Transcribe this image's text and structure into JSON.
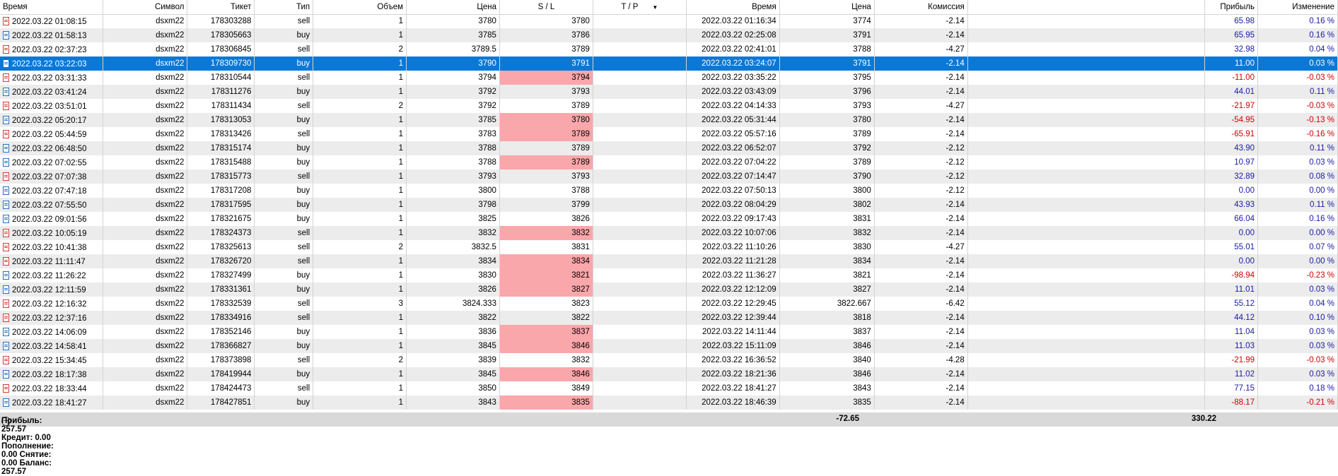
{
  "columns": [
    "Время",
    "Символ",
    "Тикет",
    "Тип",
    "Объем",
    "Цена",
    "S / L",
    "T / P",
    "Время",
    "Цена",
    "Комиссия",
    "",
    "Прибыль",
    "Изменение"
  ],
  "rows": [
    [
      "2022.03.22 01:08:15",
      "dsxm22",
      "178303288",
      "sell",
      "1",
      "3780",
      "3780",
      "",
      "2022.03.22 01:16:34",
      "3774",
      "-2.14",
      "",
      "65.98",
      "0.16 %"
    ],
    [
      "2022.03.22 01:58:13",
      "dsxm22",
      "178305663",
      "buy",
      "1",
      "3785",
      "3786",
      "",
      "2022.03.22 02:25:08",
      "3791",
      "-2.14",
      "",
      "65.95",
      "0.16 %"
    ],
    [
      "2022.03.22 02:37:23",
      "dsxm22",
      "178306845",
      "sell",
      "2",
      "3789.5",
      "3789",
      "",
      "2022.03.22 02:41:01",
      "3788",
      "-4.27",
      "",
      "32.98",
      "0.04 %"
    ],
    [
      "2022.03.22 03:22:03",
      "dsxm22",
      "178309730",
      "buy",
      "1",
      "3790",
      "3791",
      "",
      "2022.03.22 03:24:07",
      "3791",
      "-2.14",
      "",
      "11.00",
      "0.03 %"
    ],
    [
      "2022.03.22 03:31:33",
      "dsxm22",
      "178310544",
      "sell",
      "1",
      "3794",
      "3794",
      "",
      "2022.03.22 03:35:22",
      "3795",
      "-2.14",
      "",
      "-11.00",
      "-0.03 %"
    ],
    [
      "2022.03.22 03:41:24",
      "dsxm22",
      "178311276",
      "buy",
      "1",
      "3792",
      "3793",
      "",
      "2022.03.22 03:43:09",
      "3796",
      "-2.14",
      "",
      "44.01",
      "0.11 %"
    ],
    [
      "2022.03.22 03:51:01",
      "dsxm22",
      "178311434",
      "sell",
      "2",
      "3792",
      "3789",
      "",
      "2022.03.22 04:14:33",
      "3793",
      "-4.27",
      "",
      "-21.97",
      "-0.03 %"
    ],
    [
      "2022.03.22 05:20:17",
      "dsxm22",
      "178313053",
      "buy",
      "1",
      "3785",
      "3780",
      "",
      "2022.03.22 05:31:44",
      "3780",
      "-2.14",
      "",
      "-54.95",
      "-0.13 %"
    ],
    [
      "2022.03.22 05:44:59",
      "dsxm22",
      "178313426",
      "sell",
      "1",
      "3783",
      "3789",
      "",
      "2022.03.22 05:57:16",
      "3789",
      "-2.14",
      "",
      "-65.91",
      "-0.16 %"
    ],
    [
      "2022.03.22 06:48:50",
      "dsxm22",
      "178315174",
      "buy",
      "1",
      "3788",
      "3789",
      "",
      "2022.03.22 06:52:07",
      "3792",
      "-2.12",
      "",
      "43.90",
      "0.11 %"
    ],
    [
      "2022.03.22 07:02:55",
      "dsxm22",
      "178315488",
      "buy",
      "1",
      "3788",
      "3789",
      "",
      "2022.03.22 07:04:22",
      "3789",
      "-2.12",
      "",
      "10.97",
      "0.03 %"
    ],
    [
      "2022.03.22 07:07:38",
      "dsxm22",
      "178315773",
      "sell",
      "1",
      "3793",
      "3793",
      "",
      "2022.03.22 07:14:47",
      "3790",
      "-2.12",
      "",
      "32.89",
      "0.08 %"
    ],
    [
      "2022.03.22 07:47:18",
      "dsxm22",
      "178317208",
      "buy",
      "1",
      "3800",
      "3788",
      "",
      "2022.03.22 07:50:13",
      "3800",
      "-2.12",
      "",
      "0.00",
      "0.00 %"
    ],
    [
      "2022.03.22 07:55:50",
      "dsxm22",
      "178317595",
      "buy",
      "1",
      "3798",
      "3799",
      "",
      "2022.03.22 08:04:29",
      "3802",
      "-2.14",
      "",
      "43.93",
      "0.11 %"
    ],
    [
      "2022.03.22 09:01:56",
      "dsxm22",
      "178321675",
      "buy",
      "1",
      "3825",
      "3826",
      "",
      "2022.03.22 09:17:43",
      "3831",
      "-2.14",
      "",
      "66.04",
      "0.16 %"
    ],
    [
      "2022.03.22 10:05:19",
      "dsxm22",
      "178324373",
      "sell",
      "1",
      "3832",
      "3832",
      "",
      "2022.03.22 10:07:06",
      "3832",
      "-2.14",
      "",
      "0.00",
      "0.00 %"
    ],
    [
      "2022.03.22 10:41:38",
      "dsxm22",
      "178325613",
      "sell",
      "2",
      "3832.5",
      "3831",
      "",
      "2022.03.22 11:10:26",
      "3830",
      "-4.27",
      "",
      "55.01",
      "0.07 %"
    ],
    [
      "2022.03.22 11:11:47",
      "dsxm22",
      "178326720",
      "sell",
      "1",
      "3834",
      "3834",
      "",
      "2022.03.22 11:21:28",
      "3834",
      "-2.14",
      "",
      "0.00",
      "0.00 %"
    ],
    [
      "2022.03.22 11:26:22",
      "dsxm22",
      "178327499",
      "buy",
      "1",
      "3830",
      "3821",
      "",
      "2022.03.22 11:36:27",
      "3821",
      "-2.14",
      "",
      "-98.94",
      "-0.23 %"
    ],
    [
      "2022.03.22 12:11:59",
      "dsxm22",
      "178331361",
      "buy",
      "1",
      "3826",
      "3827",
      "",
      "2022.03.22 12:12:09",
      "3827",
      "-2.14",
      "",
      "11.01",
      "0.03 %"
    ],
    [
      "2022.03.22 12:16:32",
      "dsxm22",
      "178332539",
      "sell",
      "3",
      "3824.333",
      "3823",
      "",
      "2022.03.22 12:29:45",
      "3822.667",
      "-6.42",
      "",
      "55.12",
      "0.04 %"
    ],
    [
      "2022.03.22 12:37:16",
      "dsxm22",
      "178334916",
      "sell",
      "1",
      "3822",
      "3822",
      "",
      "2022.03.22 12:39:44",
      "3818",
      "-2.14",
      "",
      "44.12",
      "0.10 %"
    ],
    [
      "2022.03.22 14:06:09",
      "dsxm22",
      "178352146",
      "buy",
      "1",
      "3836",
      "3837",
      "",
      "2022.03.22 14:11:44",
      "3837",
      "-2.14",
      "",
      "11.04",
      "0.03 %"
    ],
    [
      "2022.03.22 14:58:41",
      "dsxm22",
      "178366827",
      "buy",
      "1",
      "3845",
      "3846",
      "",
      "2022.03.22 15:11:09",
      "3846",
      "-2.14",
      "",
      "11.03",
      "0.03 %"
    ],
    [
      "2022.03.22 15:34:45",
      "dsxm22",
      "178373898",
      "sell",
      "2",
      "3839",
      "3832",
      "",
      "2022.03.22 16:36:52",
      "3840",
      "-4.28",
      "",
      "-21.99",
      "-0.03 %"
    ],
    [
      "2022.03.22 18:17:38",
      "dsxm22",
      "178419944",
      "buy",
      "1",
      "3845",
      "3846",
      "",
      "2022.03.22 18:21:36",
      "3846",
      "-2.14",
      "",
      "11.02",
      "0.03 %"
    ],
    [
      "2022.03.22 18:33:44",
      "dsxm22",
      "178424473",
      "sell",
      "1",
      "3850",
      "3849",
      "",
      "2022.03.22 18:41:27",
      "3843",
      "-2.14",
      "",
      "77.15",
      "0.18 %"
    ],
    [
      "2022.03.22 18:41:27",
      "dsxm22",
      "178427851",
      "buy",
      "1",
      "3843",
      "3835",
      "",
      "2022.03.22 18:46:39",
      "3835",
      "-2.14",
      "",
      "-88.17",
      "-0.21 %"
    ]
  ],
  "sl_highlight_rows": [
    4,
    7,
    8,
    10,
    15,
    17,
    18,
    19,
    22,
    23,
    25,
    27
  ],
  "selected_row": 3,
  "footer": {
    "summary": "Прибыль: 257.57  Кредит: 0.00  Пополнение: 0.00  Снятие: 0.00  Баланс: 257.57",
    "commission_total": "-72.65",
    "profit_total": "330.22"
  },
  "colors": {
    "selected": "#0a78d7",
    "sl_hit": "#f9a7aa",
    "profit_positive": "#1a1aa6",
    "profit_negative": "#d00000"
  }
}
